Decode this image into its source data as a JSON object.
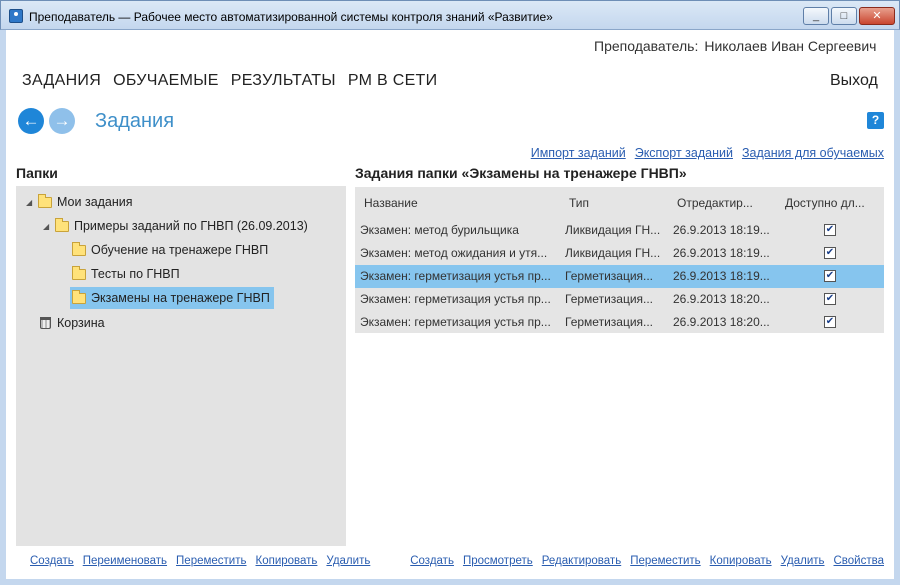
{
  "window": {
    "title": "Преподаватель — Рабочее место автоматизированной системы контроля знаний «Развитие»",
    "minimize_glyph": "_",
    "maximize_glyph": "□",
    "close_glyph": "✕"
  },
  "user": {
    "label": "Преподаватель:",
    "name": "Николаев Иван Сергеевич"
  },
  "menu": {
    "items": [
      {
        "label": "ЗАДАНИЯ"
      },
      {
        "label": "ОБУЧАЕМЫЕ"
      },
      {
        "label": "РЕЗУЛЬТАТЫ"
      },
      {
        "label": "РМ В СЕТИ"
      }
    ],
    "logout": "Выход"
  },
  "page": {
    "title": "Задания",
    "back_glyph": "←",
    "forward_glyph": "→",
    "help_glyph": "?"
  },
  "top_links": [
    "Импорт заданий",
    "Экспорт заданий",
    "Задания для обучаемых"
  ],
  "folders": {
    "title": "Папки",
    "tree": [
      {
        "label": "Мои задания",
        "expanded": true
      },
      {
        "label": "Примеры заданий по ГНВП (26.09.2013)",
        "expanded": true
      },
      {
        "label": "Обучение на тренажере ГНВП"
      },
      {
        "label": "Тесты по ГНВП"
      },
      {
        "label": "Экзамены на тренажере ГНВП",
        "selected": true
      },
      {
        "label": "Корзина"
      }
    ],
    "actions": [
      "Создать",
      "Переименовать",
      "Переместить",
      "Копировать",
      "Удалить"
    ]
  },
  "tasks": {
    "title": "Задания папки «Экзамены на тренажере ГНВП»",
    "columns": [
      "Название",
      "Тип",
      "Отредактир...",
      "Доступно дл..."
    ],
    "rows": [
      {
        "name": "Экзамен: метод бурильщика",
        "type": "Ликвидация ГН...",
        "date": "26.9.2013 18:19...",
        "available": true
      },
      {
        "name": "Экзамен: метод ожидания и утя...",
        "type": "Ликвидация ГН...",
        "date": "26.9.2013 18:19...",
        "available": true
      },
      {
        "name": "Экзамен: герметизация устья пр...",
        "type": "Герметизация...",
        "date": "26.9.2013 18:19...",
        "available": true,
        "selected": true
      },
      {
        "name": "Экзамен: герметизация устья пр...",
        "type": "Герметизация...",
        "date": "26.9.2013 18:20...",
        "available": true
      },
      {
        "name": "Экзамен: герметизация устья пр...",
        "type": "Герметизация...",
        "date": "26.9.2013 18:20...",
        "available": true
      }
    ],
    "actions": [
      "Создать",
      "Просмотреть",
      "Редактировать",
      "Переместить",
      "Копировать",
      "Удалить",
      "Свойства"
    ]
  },
  "colors": {
    "accent": "#3e8fc9",
    "selection": "#86c5ee",
    "link": "#2a5db0"
  }
}
